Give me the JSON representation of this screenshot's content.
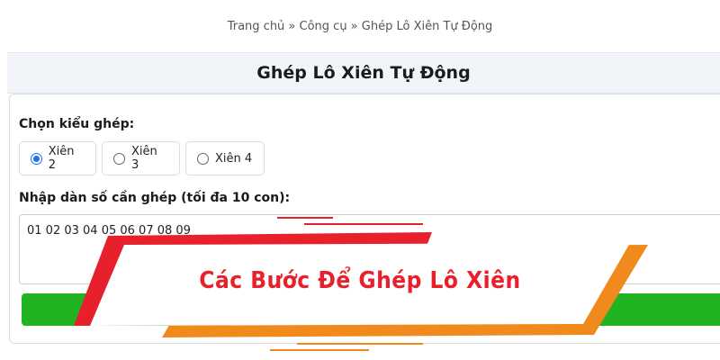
{
  "breadcrumb": "Trang chủ » Công cụ » Ghép Lô Xiên Tự Động",
  "page_title": "Ghép Lô Xiên Tự Động",
  "form": {
    "type_label": "Chọn kiểu ghép:",
    "options": [
      "Xiên 2",
      "Xiên 3",
      "Xiên 4"
    ],
    "selected": "Xiên 2",
    "input_label": "Nhập dàn số cần ghép (tối đa 10 con):",
    "input_value": "01 02 03 04 05 06 07 08 09"
  },
  "banner": {
    "text": "Các Bước Để Ghép Lô Xiên"
  },
  "colors": {
    "accent_red": "#e8202c",
    "accent_orange": "#f08a1c",
    "button_green": "#22b322",
    "radio_blue": "#1a73e8"
  }
}
